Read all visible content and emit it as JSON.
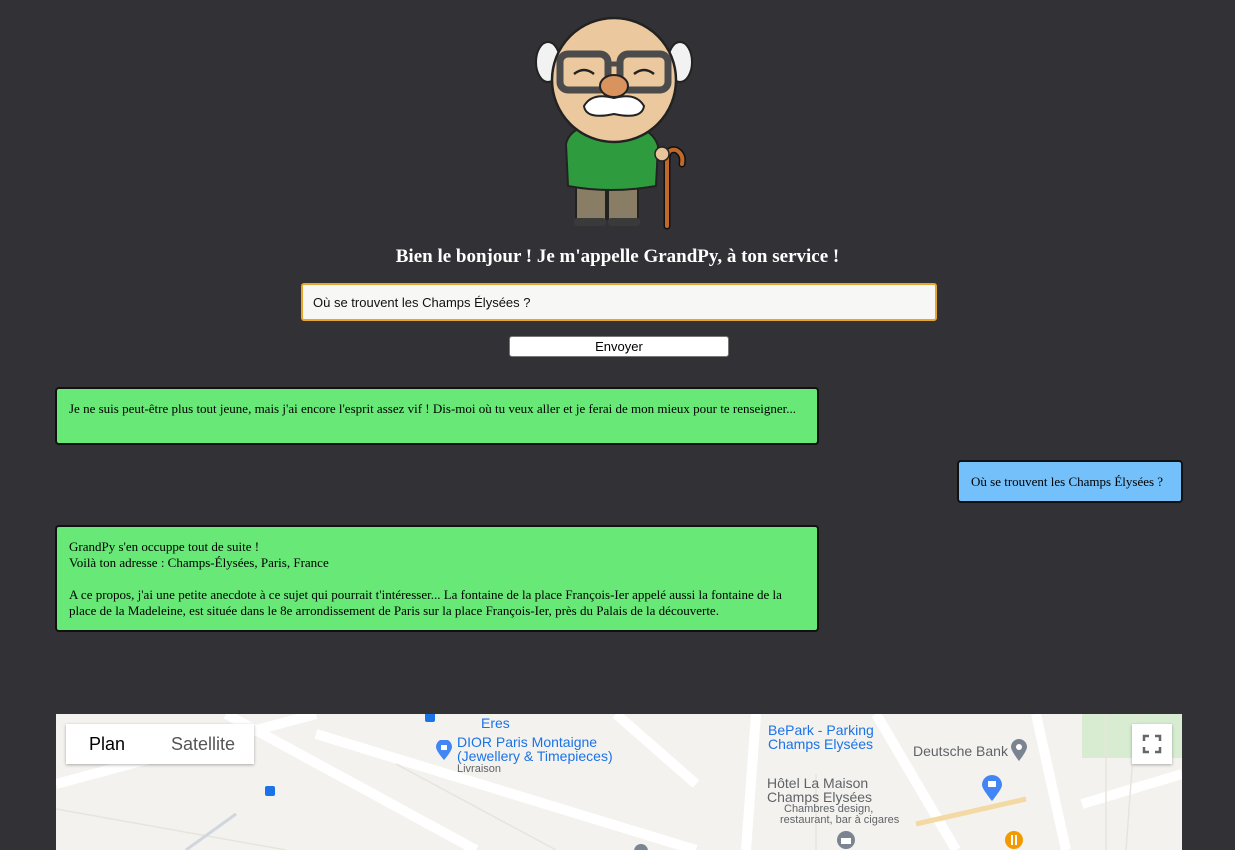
{
  "header": {
    "title": "Bien le bonjour ! Je m'appelle GrandPy, à ton service !"
  },
  "form": {
    "query_value": "Où se trouvent les Champs Élysées ?",
    "send_label": "Envoyer"
  },
  "messages": [
    {
      "from": "bot",
      "lines": [
        "Je ne suis peut-être plus tout jeune, mais j'ai encore l'esprit assez vif ! Dis-moi où tu veux aller et je ferai de mon mieux pour te renseigner..."
      ]
    },
    {
      "from": "user",
      "text": "Où se trouvent les Champs Élysées ?"
    },
    {
      "from": "bot",
      "line1": "GrandPy s'en occuppe tout de suite !",
      "line2": "Voilà ton adresse : Champs-Élysées, Paris, France",
      "anecdote": "A ce propos, j'ai une petite anecdote à ce sujet qui pourrait t'intéresser... La fontaine de la place François-Ier appelé aussi la fontaine de la place de la Madeleine, est située dans le 8e arrondissement de Paris sur la place François-Ier, près du Palais de la découverte."
    }
  ],
  "map": {
    "type_plan": "Plan",
    "type_satellite": "Satellite",
    "pois": {
      "eres": "Eres",
      "dior_1": "DIOR Paris Montaigne",
      "dior_2": "(Jewellery & Timepieces)",
      "dior_3": "Livraison",
      "bepark_1": "BePark - Parking",
      "bepark_2": "Champs Elysées",
      "deutsche": "Deutsche Bank",
      "hotel_1": "Hôtel La Maison",
      "hotel_2": "Champs Elysées",
      "hotel_3": "Chambres design,",
      "hotel_4": "restaurant, bar à cigares"
    }
  },
  "colors": {
    "background": "#323135",
    "bot_bubble": "#67e877",
    "user_bubble": "#74c0fa",
    "input_border": "#e6a72a",
    "poi_blue": "#1a73e8"
  },
  "icons": {
    "avatar": "grandpy-character",
    "fullscreen": "fullscreen-icon",
    "marker": "map-pin-icon",
    "shopping": "shopping-bag-icon",
    "bus": "bus-stop-icon",
    "restaurant": "fork-knife-icon",
    "museum": "museum-icon"
  }
}
